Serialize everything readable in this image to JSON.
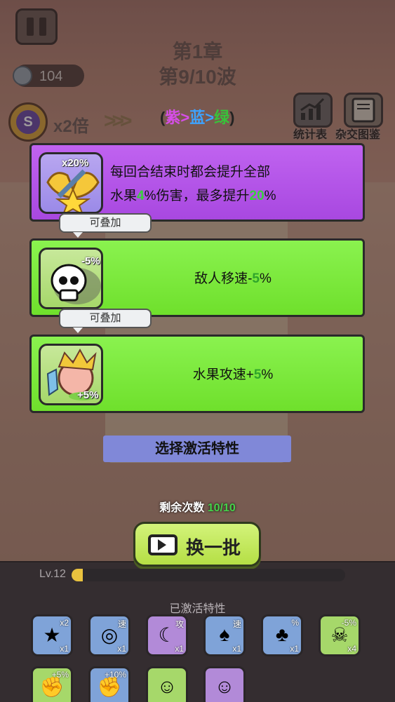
{
  "hud": {
    "coins": "104",
    "chapter": "第1章",
    "wave": "第9/10波",
    "speed_icon_letter": "S",
    "speed": "x2倍",
    "speed_chevrons": ">>>",
    "stats_label": "统计表",
    "hybrid_label": "杂交图鉴"
  },
  "tier_hint": {
    "open": "(",
    "purple": "紫",
    "sep1": ">",
    "blue": "蓝",
    "sep2": ">",
    "green": "绿",
    "close": ")"
  },
  "cards": [
    {
      "rarity": "purple",
      "badge": "x20%",
      "line1": "每回合结束时都会提升全部",
      "line2_a": "水果",
      "line2_v1": "4",
      "line2_b": "%伤害，最多提升",
      "line2_v2": "20",
      "line2_c": "%",
      "icon": "sword-wings-star-icon"
    },
    {
      "rarity": "green",
      "badge": "-5%",
      "tag": "可叠加",
      "text_a": "敌人移速-",
      "value": "5",
      "text_b": "%",
      "icon": "skull-icon"
    },
    {
      "rarity": "green",
      "badge": "+5%",
      "tag": "可叠加",
      "text_a": "水果攻速+",
      "value": "5",
      "text_b": "%",
      "icon": "jester-fruit-icon"
    }
  ],
  "select_button": "选择激活特性",
  "remaining": {
    "label": "剩余次数",
    "count": "10/10"
  },
  "refresh_button": "换一批",
  "level": {
    "label": "Lv.12",
    "progress": 0.04
  },
  "active_traits": {
    "title": "已激活特性",
    "row1": [
      {
        "icon": "leaf-star-icon",
        "top": "x2",
        "count": "x1",
        "color": "#7fa3d8"
      },
      {
        "icon": "citrus-speed-icon",
        "top": "速",
        "count": "x1",
        "color": "#7fa3d8"
      },
      {
        "icon": "crescent-attack-icon",
        "top": "攻",
        "count": "x1",
        "color": "#b28ad8"
      },
      {
        "icon": "onion-speed-icon",
        "top": "速",
        "count": "x1",
        "color": "#7fa3d8"
      },
      {
        "icon": "poison-tree-icon",
        "top": "%",
        "count": "x1",
        "color": "#7fa3d8"
      },
      {
        "icon": "skull-icon",
        "top": "-5%",
        "count": "x4",
        "color": "#a6d86a"
      }
    ],
    "row2": [
      {
        "icon": "fist-plus-icon",
        "top": "+5%",
        "color": "#a6d86a"
      },
      {
        "icon": "fist-plus-icon",
        "top": "+10%",
        "color": "#7fa3d8"
      },
      {
        "icon": "jester-fruit-icon",
        "top": "",
        "color": "#a6d86a"
      },
      {
        "icon": "jester-fruit-icon",
        "top": "",
        "color": "#b28ad8"
      }
    ]
  }
}
